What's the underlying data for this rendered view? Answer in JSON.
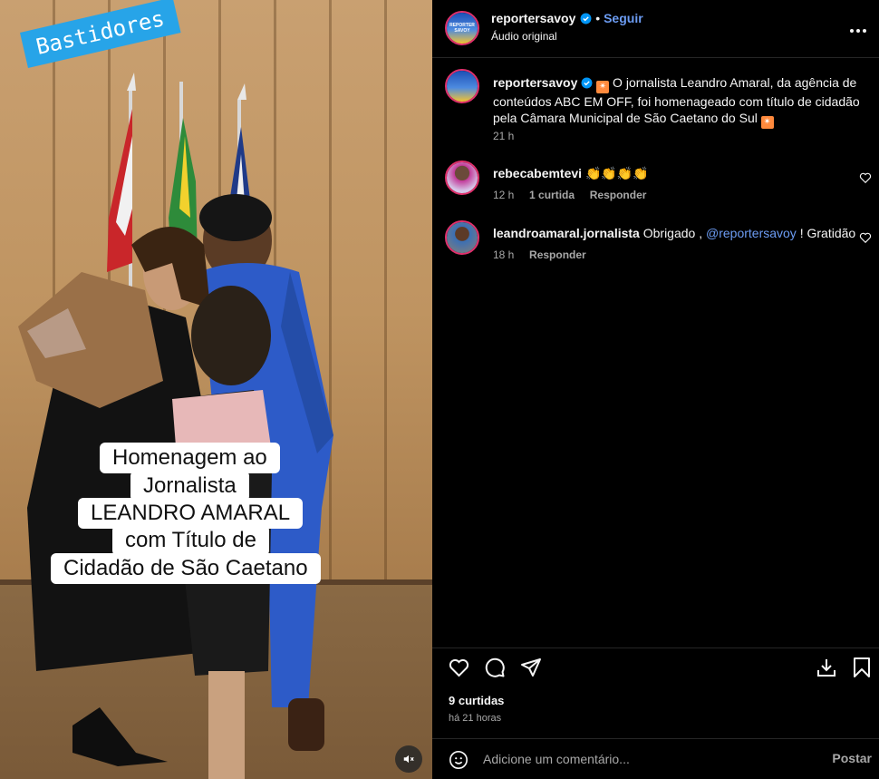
{
  "post": {
    "username": "reportersavoy",
    "follow_label": "Seguir",
    "audio_label": "Áudio original",
    "avatar_text": "REPORTER SAVOY",
    "caption_text": " O jornalista Leandro Amaral, da agência de conteúdos ABC EM OFF, foi homenageado com título de cidadão pela Câmara Municipal de São Caetano do Sul",
    "caption_time": "21 h",
    "likes": "9 curtidas",
    "time_ago": "há 21 horas"
  },
  "media": {
    "stamp_text": "Bastidores",
    "overlay_lines": [
      "Homenagem ao",
      "Jornalista",
      "LEANDRO AMARAL",
      "com Título de",
      "Cidadão de São Caetano"
    ]
  },
  "comments": [
    {
      "username": "rebecabemtevi",
      "text": "👏👏👏👏",
      "time": "12 h",
      "likes": "1 curtida",
      "reply": "Responder"
    },
    {
      "username": "leandroamaral.jornalista",
      "text_before": "Obrigado , ",
      "mention": "@reportersavoy",
      "text_after": " ! Gratidão",
      "time": "18 h",
      "reply": "Responder"
    }
  ],
  "footer": {
    "comment_placeholder": "Adicione um comentário...",
    "post_label": "Postar"
  },
  "colors": {
    "accent": "#6c9cf3",
    "stamp": "#27a4e8"
  },
  "icons": [
    "more-options-icon",
    "verified-icon",
    "heart-icon",
    "comment-icon",
    "share-icon",
    "download-icon",
    "bookmark-icon",
    "emoji-icon",
    "mute-icon"
  ]
}
